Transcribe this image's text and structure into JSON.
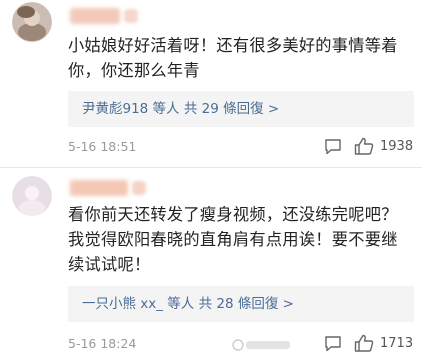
{
  "comments": [
    {
      "text": "小姑娘好好活着呀！还有很多美好的事情等着你，你还那么年青",
      "reply_summary": "尹黄彪918 等人 共 29 條回復 >",
      "timestamp": "5-16 18:51",
      "like_count": "1938"
    },
    {
      "text": "看你前天还转发了瘦身视频，还没练完呢吧？我觉得欧阳春晓的直角肩有点用诶！要不要继续试试呢！",
      "reply_summary": "一只小熊 xx_ 等人 共 28 條回復 >",
      "timestamp": "5-16 18:24",
      "like_count": "1713"
    }
  ],
  "colors": {
    "link": "#4c6d94",
    "reply_bg": "#f4f4f4",
    "meta": "#9a9a9a"
  },
  "icons": {
    "reply": "comment-bubble-icon",
    "like": "thumbs-up-icon"
  }
}
